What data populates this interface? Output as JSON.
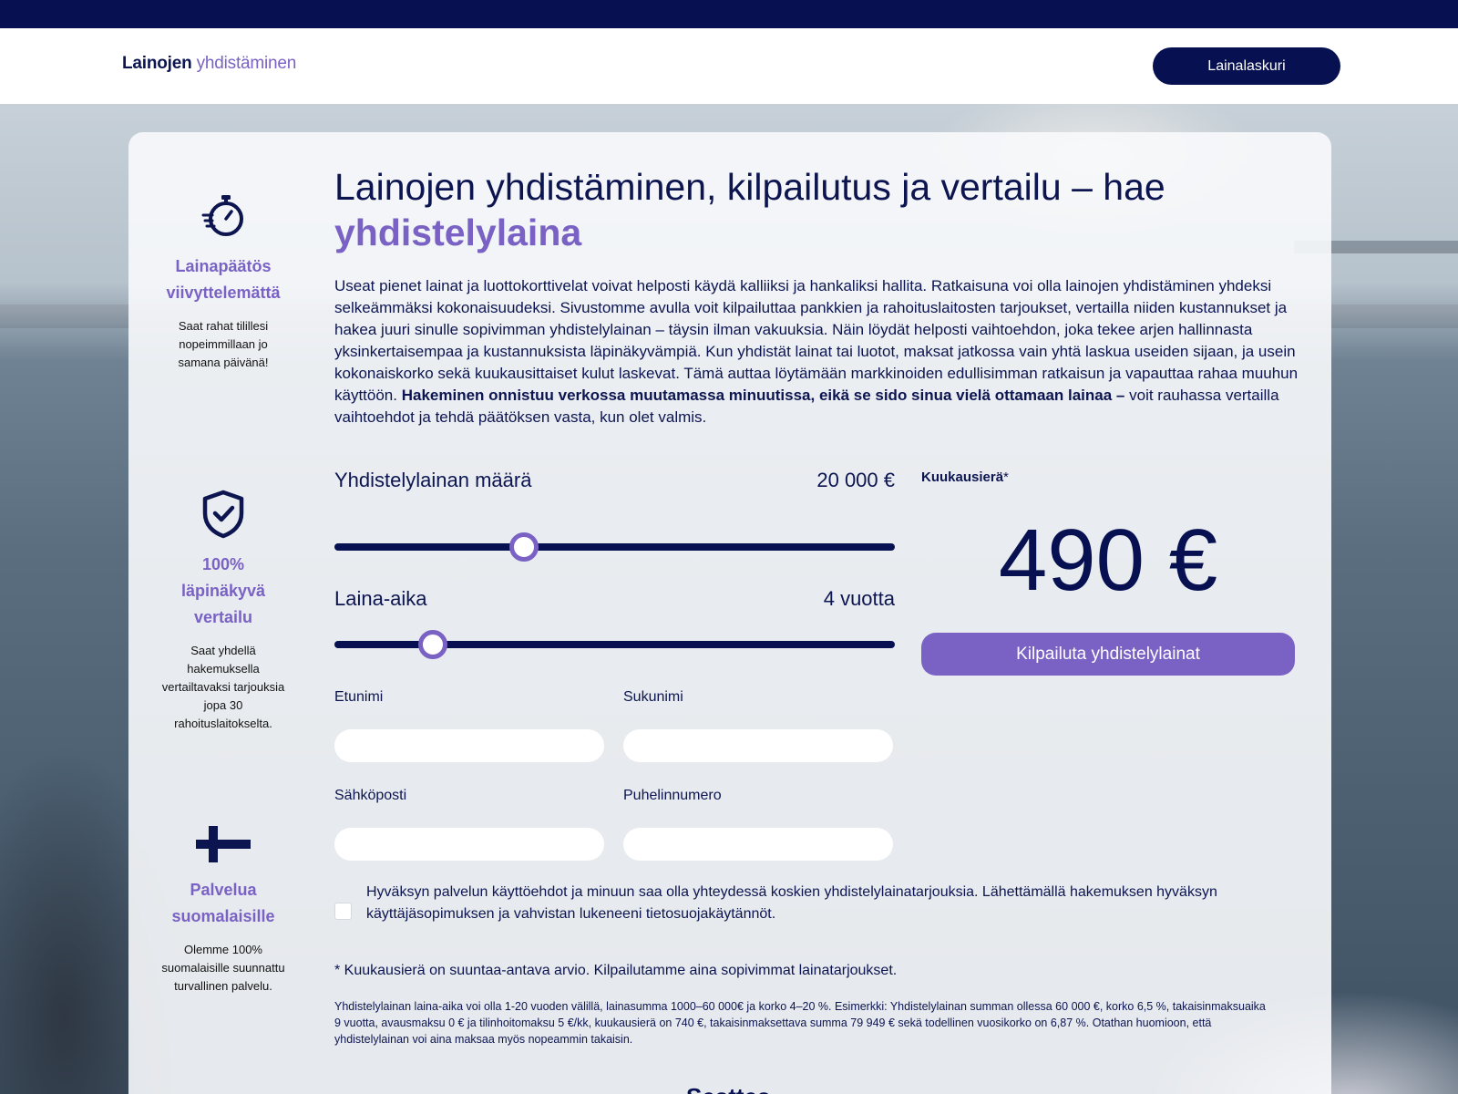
{
  "header": {
    "logo_bold": "Lainojen",
    "logo_light": "yhdistäminen",
    "calculator_button": "Lainalaskuri"
  },
  "features": [
    {
      "icon": "stopwatch-icon",
      "title": "Lainapäätös viivyttelemättä",
      "description": "Saat rahat tilillesi nopeimmillaan jo samana päivänä!"
    },
    {
      "icon": "shield-check-icon",
      "title": "100% läpinäkyvä vertailu",
      "description": "Saat yhdellä hakemuksella vertailtavaksi tarjouksia jopa 30 rahoituslaitokselta."
    },
    {
      "icon": "finnish-cross-icon",
      "title": "Palvelua suomalaisille",
      "description": "Olemme 100% suomalaisille suunnattu turvallinen palvelu."
    }
  ],
  "hero": {
    "title": "Lainojen yhdistäminen, kilpailutus ja vertailu – hae",
    "title_highlight": "yhdistelylaina",
    "intro_text": "Useat pienet lainat ja luottokorttivelat voivat helposti käydä kalliiksi ja hankaliksi hallita. Ratkaisuna voi olla lainojen yhdistäminen yhdeksi selkeämmäksi kokonaisuudeksi. Sivustomme avulla voit kilpailuttaa pankkien ja rahoituslaitosten tarjoukset, vertailla niiden kustannukset ja hakea juuri sinulle sopivimman yhdistelylainan – täysin ilman vakuuksia. Näin löydät helposti vaihtoehdon, joka tekee arjen hallinnasta yksinkertaisempaa ja kustannuksista läpinäkyvämpiä. Kun yhdistät lainat tai luotot, maksat jatkossa vain yhtä laskua useiden sijaan, ja usein kokonaiskorko sekä kuukausittaiset kulut laskevat. Tämä auttaa löytämään markkinoiden edullisimman ratkaisun ja vapauttaa rahaa muuhun käyttöön.",
    "intro_bold": "Hakeminen onnistuu verkossa muutamassa minuutissa, eikä se sido sinua vielä ottamaan lainaa –",
    "intro_tail": "voit rauhassa vertailla vaihtoehdot ja tehdä päätöksen vasta, kun olet valmis."
  },
  "calculator": {
    "amount_label": "Yhdistelylainan määrä",
    "amount_value": "20 000 €",
    "amount_fraction": 0.339,
    "term_label": "Laina-aika",
    "term_value": "4 vuotta",
    "term_fraction": 0.175,
    "monthly_label": "Kuukausierä",
    "monthly_asterisk": "*",
    "monthly_value": "490 €",
    "cta_button": "Kilpailuta yhdistelylainat"
  },
  "form": {
    "first_name_label": "Etunimi",
    "first_name_value": "",
    "last_name_label": "Sukunimi",
    "last_name_value": "",
    "email_label": "Sähköposti",
    "email_value": "",
    "phone_label": "Puhelinnumero",
    "phone_value": "",
    "consent_text": "Hyväksyn palvelun käyttöehdot ja minuun saa olla yhteydessä koskien yhdistelylainatarjouksia. Lähettämällä hakemuksen hyväksyn käyttäjäsopimuksen ja vahvistan lukeneeni tietosuojakäytännöt.",
    "consent_checked": false
  },
  "notes": {
    "estimate_note": "* Kuukausierä on suuntaa-antava arvio. Kilpailutamme aina sopivimmat lainatarjoukset.",
    "fine_print": "Yhdistelylainan laina-aika voi olla 1-20 vuoden välillä, lainasumma 1000–60 000€ ja korko 4–20 %. Esimerkki: Yhdistelylainan summan ollessa 60 000 €, korko 6,5 %, takaisinmaksuaika 9 vuotta, avausmaksu 0 € ja tilinhoitomaksu 5 €/kk, kuukausierä on 740 €, takaisinmaksettava summa 79 949 € sekä todellinen vuosikorko on 6,87 %. Otathan huomioon, että yhdistelylainan voi aina maksaa myös nopeammin takaisin.",
    "next_heading": "Sesttes"
  },
  "colors": {
    "navy": "#071151",
    "accent_purple": "#7a62c4"
  }
}
